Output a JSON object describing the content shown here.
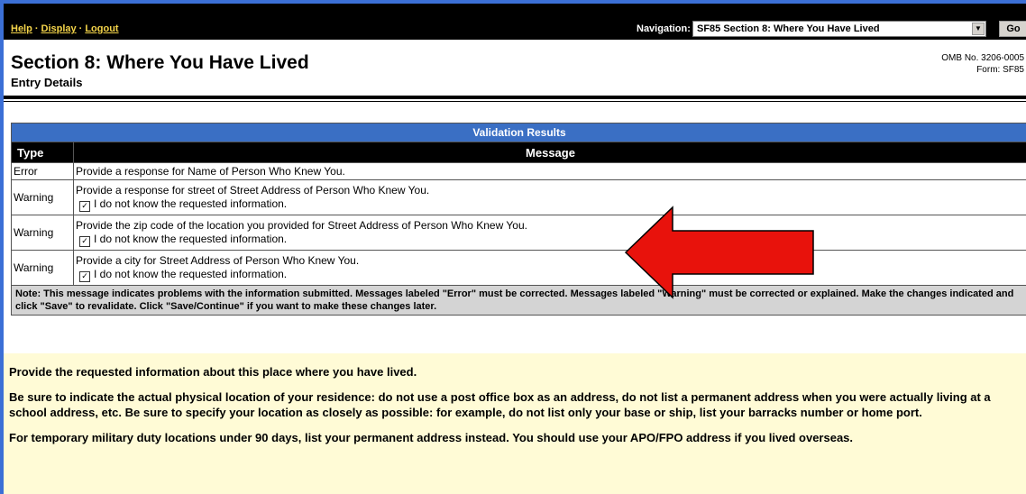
{
  "topbar": {
    "links": [
      {
        "label": "Help"
      },
      {
        "label": "Display"
      },
      {
        "label": "Logout"
      }
    ],
    "separator": "·",
    "nav_label": "Navigation:",
    "nav_selected": "SF85 Section 8: Where You Have Lived",
    "go_label": "Go"
  },
  "header": {
    "title": "Section 8: Where You Have Lived",
    "subtitle": "Entry Details",
    "omb_line1": "OMB No. 3206-0005",
    "omb_line2": "Form: SF85"
  },
  "validation": {
    "title": "Validation Results",
    "col_type": "Type",
    "col_message": "Message",
    "rows": [
      {
        "type": "Error",
        "message": "Provide a response for Name of Person Who Knew You.",
        "checkbox": null
      },
      {
        "type": "Warning",
        "message": "Provide a response for street of Street Address of Person Who Knew You.",
        "checkbox": "I do not know the requested information."
      },
      {
        "type": "Warning",
        "message": "Provide the zip code of the location you provided for Street Address of Person Who Knew You.",
        "checkbox": "I do not know the requested information."
      },
      {
        "type": "Warning",
        "message": "Provide a city for Street Address of Person Who Knew You.",
        "checkbox": "I do not know the requested information."
      }
    ],
    "note": "Note: This message indicates problems with the information submitted. Messages labeled \"Error\" must be corrected. Messages labeled \"Warning\" must be corrected or explained. Make the changes indicated and click \"Save\" to revalidate. Click \"Save/Continue\" if you want to make these changes later."
  },
  "info": {
    "p1": "Provide the requested information about this place where you have lived.",
    "p2": "Be sure to indicate the actual physical location of your residence: do not use a post office box as an address, do not list a permanent address when you were actually living at a school address, etc. Be sure to specify your location as closely as possible: for example, do not list only your base or ship, list your barracks number or home port.",
    "p3": "For temporary military duty locations under 90 days, list your permanent address instead. You should use your APO/FPO address if you lived overseas."
  },
  "colors": {
    "frame": "#3b6fd6",
    "link": "#f4d44a",
    "table_header": "#3a6fc4",
    "info_bg": "#fffbd6",
    "arrow": "#e8120c"
  }
}
